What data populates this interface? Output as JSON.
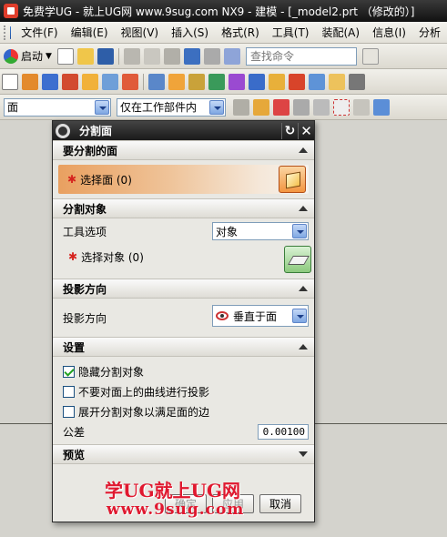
{
  "window": {
    "title": "免费学UG - 就上UG网 www.9sug.com   NX9 - 建模 - [_model2.prt （修改的）]"
  },
  "menubar": {
    "items": [
      "文件(F)",
      "编辑(E)",
      "视图(V)",
      "插入(S)",
      "格式(R)",
      "工具(T)",
      "装配(A)",
      "信息(I)",
      "分析"
    ]
  },
  "toolbar": {
    "start_label": "启动",
    "search_placeholder": "查找命令"
  },
  "filters": {
    "type_filter": "面",
    "scope_filter": "仅在工作部件内"
  },
  "dialog": {
    "title": "分割面",
    "sections": {
      "face_to_split": {
        "header": "要分割的面",
        "select_label": "选择面 (0)"
      },
      "split_objects": {
        "header": "分割对象",
        "tool_option_label": "工具选项",
        "tool_option_value": "对象",
        "select_object_label": "选择对象 (0)"
      },
      "projection": {
        "header": "投影方向",
        "direction_label": "投影方向",
        "direction_value": "垂直于面"
      },
      "settings": {
        "header": "设置",
        "hide_split_objects": "隐藏分割对象",
        "no_project_curves": "不要对面上的曲线进行投影",
        "unfold_split_objects": "展开分割对象以满足面的边",
        "tolerance_label": "公差",
        "tolerance_value": "0.00100"
      },
      "preview": {
        "header": "预览"
      }
    },
    "buttons": {
      "ok": "确定",
      "apply": "应用",
      "cancel": "取消"
    }
  },
  "watermark": {
    "line1": "学UG就上UG网",
    "line2": "www.9sug.com"
  },
  "colors": {
    "dialog_title_bg": "#1a1a1a",
    "required_star": "#d6231e",
    "select_highlight": "#e9a060",
    "watermark": "#e0182f"
  }
}
